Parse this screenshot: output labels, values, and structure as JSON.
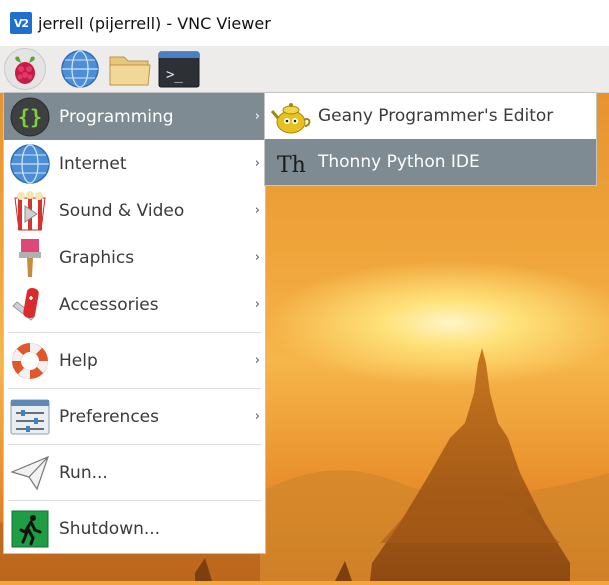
{
  "window": {
    "title": "jerrell (pijerrell) - VNC Viewer",
    "logo_text": "V2"
  },
  "taskbar": {
    "icons": [
      "raspberry-menu-icon",
      "web-browser-icon",
      "file-manager-icon",
      "terminal-icon"
    ],
    "terminal_glyph": ">_"
  },
  "menu": {
    "items": [
      {
        "label": "Programming",
        "icon": "programming-braces-icon",
        "submenu": true,
        "active": true
      },
      {
        "label": "Internet",
        "icon": "globe-icon",
        "submenu": true
      },
      {
        "label": "Sound & Video",
        "icon": "popcorn-icon",
        "submenu": true
      },
      {
        "label": "Graphics",
        "icon": "paintbrush-icon",
        "submenu": true
      },
      {
        "label": "Accessories",
        "icon": "pocket-knife-icon",
        "submenu": true
      },
      {
        "label": "Help",
        "icon": "lifebuoy-icon",
        "submenu": true
      },
      {
        "label": "Preferences",
        "icon": "sliders-icon",
        "submenu": true
      },
      {
        "label": "Run...",
        "icon": "paper-plane-icon",
        "submenu": false
      },
      {
        "label": "Shutdown...",
        "icon": "exit-running-man-icon",
        "submenu": false
      }
    ],
    "arrow": "›"
  },
  "submenu": {
    "items": [
      {
        "label": "Geany Programmer's Editor",
        "icon": "geany-teapot-icon"
      },
      {
        "label": "Thonny Python IDE",
        "icon": "thonny-th-icon",
        "active": true,
        "glyph": "Th"
      }
    ]
  },
  "colors": {
    "highlight": "#7e8b92",
    "menu_bg": "#ffffff",
    "taskbar_bg": "#edecea"
  }
}
